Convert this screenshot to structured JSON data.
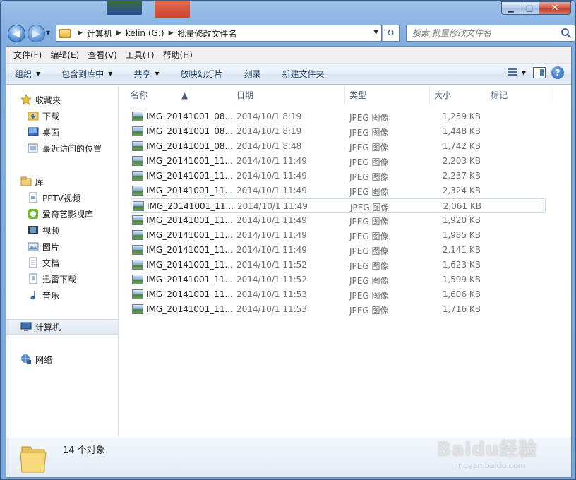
{
  "window": {
    "buttons": {
      "minimize": "▁",
      "maximize": "□",
      "close": "✕"
    }
  },
  "navigation": {
    "breadcrumb": [
      "计算机",
      "kelin (G:)",
      "批量修改文件名"
    ]
  },
  "search": {
    "placeholder": "搜索 批量修改文件名"
  },
  "menubar": {
    "items": [
      "文件(F)",
      "编辑(E)",
      "查看(V)",
      "工具(T)",
      "帮助(H)"
    ]
  },
  "commandbar": {
    "organize": "组织",
    "include_library": "包含到库中",
    "share": "共享",
    "slideshow": "放映幻灯片",
    "burn": "刻录",
    "new_folder": "新建文件夹"
  },
  "sidebar": {
    "favorites": {
      "label": "收藏夹",
      "items": [
        "下载",
        "桌面",
        "最近访问的位置"
      ]
    },
    "libraries": {
      "label": "库",
      "items": [
        "PPTV视频",
        "爱奇艺影视库",
        "视频",
        "图片",
        "文档",
        "迅雷下载",
        "音乐"
      ]
    },
    "computer": "计算机",
    "network": "网络"
  },
  "columns": {
    "name": "名称",
    "date": "日期",
    "type": "类型",
    "size": "大小",
    "tags": "标记"
  },
  "files": [
    {
      "name": "IMG_20141001_08...",
      "date": "2014/10/1 8:19",
      "type": "JPEG 图像",
      "size": "1,259 KB"
    },
    {
      "name": "IMG_20141001_08...",
      "date": "2014/10/1 8:19",
      "type": "JPEG 图像",
      "size": "1,448 KB"
    },
    {
      "name": "IMG_20141001_08...",
      "date": "2014/10/1 8:48",
      "type": "JPEG 图像",
      "size": "1,742 KB"
    },
    {
      "name": "IMG_20141001_11...",
      "date": "2014/10/1 11:49",
      "type": "JPEG 图像",
      "size": "2,203 KB"
    },
    {
      "name": "IMG_20141001_11...",
      "date": "2014/10/1 11:49",
      "type": "JPEG 图像",
      "size": "2,237 KB"
    },
    {
      "name": "IMG_20141001_11...",
      "date": "2014/10/1 11:49",
      "type": "JPEG 图像",
      "size": "2,324 KB"
    },
    {
      "name": "IMG_20141001_11...",
      "date": "2014/10/1 11:49",
      "type": "JPEG 图像",
      "size": "2,061 KB"
    },
    {
      "name": "IMG_20141001_11...",
      "date": "2014/10/1 11:49",
      "type": "JPEG 图像",
      "size": "1,920 KB"
    },
    {
      "name": "IMG_20141001_11...",
      "date": "2014/10/1 11:49",
      "type": "JPEG 图像",
      "size": "1,985 KB"
    },
    {
      "name": "IMG_20141001_11...",
      "date": "2014/10/1 11:49",
      "type": "JPEG 图像",
      "size": "2,141 KB"
    },
    {
      "name": "IMG_20141001_11...",
      "date": "2014/10/1 11:52",
      "type": "JPEG 图像",
      "size": "1,623 KB"
    },
    {
      "name": "IMG_20141001_11...",
      "date": "2014/10/1 11:52",
      "type": "JPEG 图像",
      "size": "1,599 KB"
    },
    {
      "name": "IMG_20141001_11...",
      "date": "2014/10/1 11:53",
      "type": "JPEG 图像",
      "size": "1,606 KB"
    },
    {
      "name": "IMG_20141001_11...",
      "date": "2014/10/1 11:53",
      "type": "JPEG 图像",
      "size": "1,716 KB"
    }
  ],
  "details": {
    "count": "14 个对象"
  },
  "watermark": {
    "brand": "Baidu经验",
    "url": "jingyan.baidu.com"
  },
  "colors": {
    "frame": "#7aa6da",
    "accent": "#1e395b",
    "selected_row": "#c9d9ee"
  }
}
